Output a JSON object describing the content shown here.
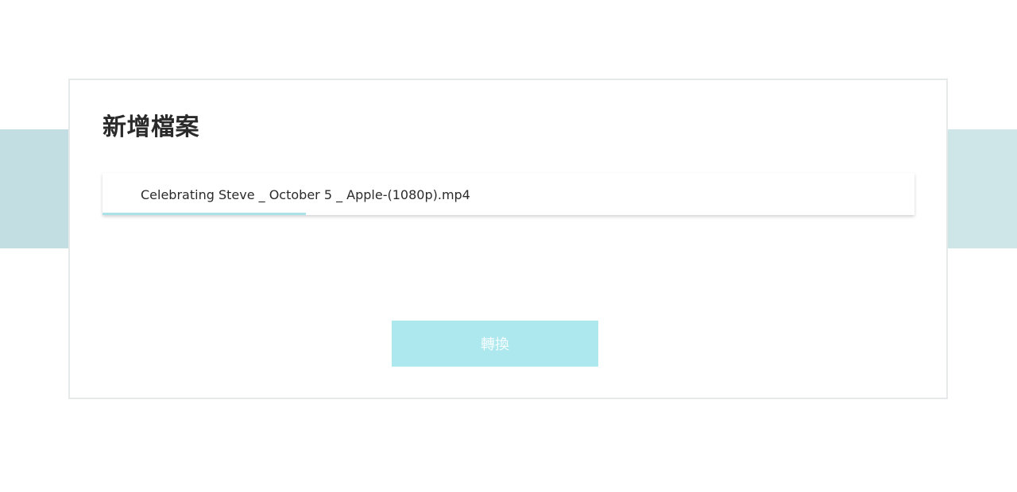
{
  "card": {
    "title": "新增檔案"
  },
  "file": {
    "name": "Celebrating Steve _ October 5 _ Apple-(1080p).mp4",
    "progress_fraction": 0.25
  },
  "actions": {
    "convert_label": "轉換"
  },
  "colors": {
    "band": "#c5e0e4",
    "progress": "#a9e2e9",
    "button_bg": "#ade8ee",
    "button_text": "#f7fdfe",
    "card_border": "#e6e9ea"
  }
}
